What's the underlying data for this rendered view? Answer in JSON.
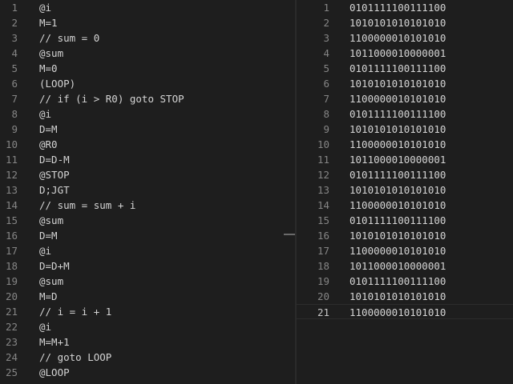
{
  "left_editor": {
    "lines": [
      {
        "n": "1",
        "code": "@i"
      },
      {
        "n": "2",
        "code": "M=1"
      },
      {
        "n": "3",
        "code": "// sum = 0"
      },
      {
        "n": "4",
        "code": "@sum"
      },
      {
        "n": "5",
        "code": "M=0"
      },
      {
        "n": "6",
        "code": "(LOOP)"
      },
      {
        "n": "7",
        "code": "// if (i > R0) goto STOP"
      },
      {
        "n": "8",
        "code": "@i"
      },
      {
        "n": "9",
        "code": "D=M"
      },
      {
        "n": "10",
        "code": "@R0"
      },
      {
        "n": "11",
        "code": "D=D-M"
      },
      {
        "n": "12",
        "code": "@STOP"
      },
      {
        "n": "13",
        "code": "D;JGT"
      },
      {
        "n": "14",
        "code": "// sum = sum + i"
      },
      {
        "n": "15",
        "code": "@sum"
      },
      {
        "n": "16",
        "code": "D=M"
      },
      {
        "n": "17",
        "code": "@i"
      },
      {
        "n": "18",
        "code": "D=D+M"
      },
      {
        "n": "19",
        "code": "@sum"
      },
      {
        "n": "20",
        "code": "M=D"
      },
      {
        "n": "21",
        "code": "// i = i + 1"
      },
      {
        "n": "22",
        "code": "@i"
      },
      {
        "n": "23",
        "code": "M=M+1"
      },
      {
        "n": "24",
        "code": "// goto LOOP"
      },
      {
        "n": "25",
        "code": "@LOOP"
      }
    ]
  },
  "right_editor": {
    "active_line": "21",
    "lines": [
      {
        "n": "1",
        "code": "0101111100111100"
      },
      {
        "n": "2",
        "code": "1010101010101010"
      },
      {
        "n": "3",
        "code": "1100000010101010"
      },
      {
        "n": "4",
        "code": "1011000010000001"
      },
      {
        "n": "5",
        "code": "0101111100111100"
      },
      {
        "n": "6",
        "code": "1010101010101010"
      },
      {
        "n": "7",
        "code": "1100000010101010"
      },
      {
        "n": "8",
        "code": "0101111100111100"
      },
      {
        "n": "9",
        "code": "1010101010101010"
      },
      {
        "n": "10",
        "code": "1100000010101010"
      },
      {
        "n": "11",
        "code": "1011000010000001"
      },
      {
        "n": "12",
        "code": "0101111100111100"
      },
      {
        "n": "13",
        "code": "1010101010101010"
      },
      {
        "n": "14",
        "code": "1100000010101010"
      },
      {
        "n": "15",
        "code": "0101111100111100"
      },
      {
        "n": "16",
        "code": "1010101010101010"
      },
      {
        "n": "17",
        "code": "1100000010101010"
      },
      {
        "n": "18",
        "code": "1011000010000001"
      },
      {
        "n": "19",
        "code": "0101111100111100"
      },
      {
        "n": "20",
        "code": "1010101010101010"
      },
      {
        "n": "21",
        "code": "1100000010101010"
      }
    ]
  },
  "colors": {
    "background": "#1e1e1e",
    "text": "#d4d4d4",
    "line_number": "#858585",
    "active_line_number": "#c6c6c6"
  }
}
